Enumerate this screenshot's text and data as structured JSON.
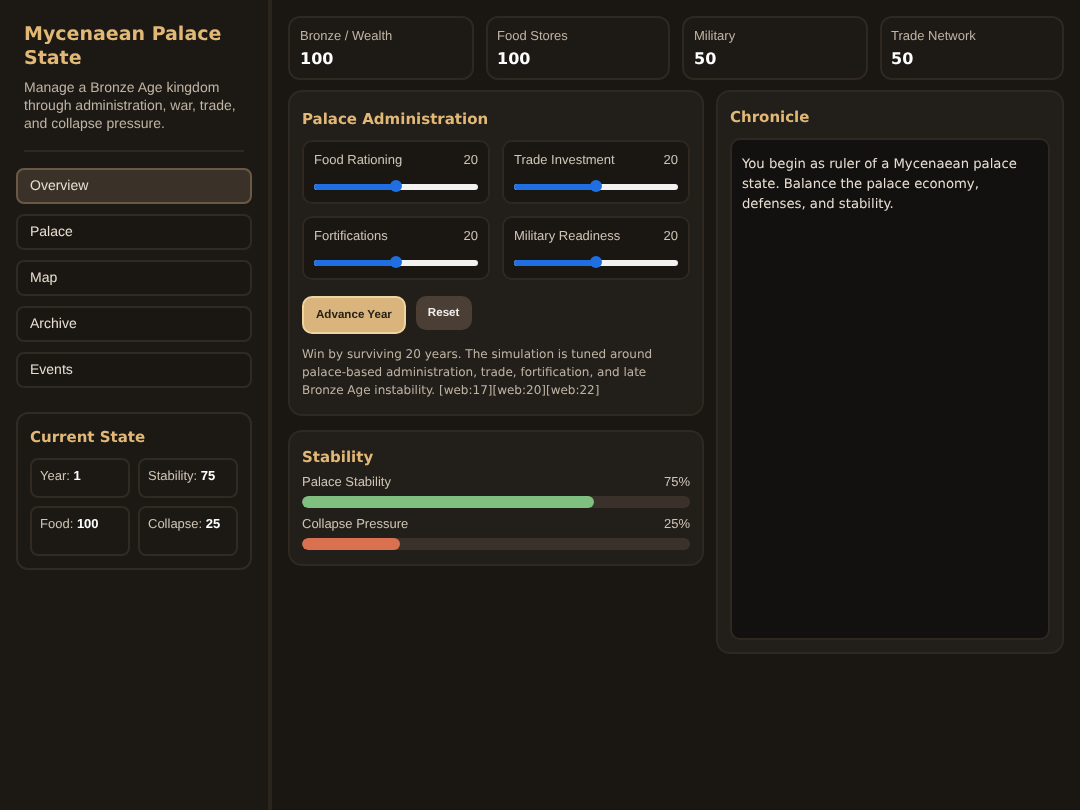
{
  "sidebar": {
    "title": "Mycenaean Palace State",
    "description": "Manage a Bronze Age kingdom through administration, war, trade, and collapse pressure.",
    "nav": [
      {
        "label": "Overview",
        "selected": true
      },
      {
        "label": "Palace",
        "selected": false
      },
      {
        "label": "Map",
        "selected": false
      },
      {
        "label": "Archive",
        "selected": false
      },
      {
        "label": "Events",
        "selected": false
      }
    ],
    "current_state": {
      "title": "Current State",
      "items": [
        "Year: **1**",
        "Stability: **75**",
        "Food: **100**",
        "Collapse: **25**"
      ]
    }
  },
  "stats": [
    {
      "label": "Bronze / Wealth",
      "value": "100"
    },
    {
      "label": "Food Stores",
      "value": "100"
    },
    {
      "label": "Military",
      "value": "50"
    },
    {
      "label": "Trade Network",
      "value": "50"
    }
  ],
  "administration": {
    "title": "Palace Administration",
    "sliders": [
      {
        "label": "Food Rationing",
        "value": "20",
        "level": 0.5
      },
      {
        "label": "Trade Investment",
        "value": "20",
        "level": 0.5
      },
      {
        "label": "Fortifications",
        "value": "20",
        "level": 0.5
      },
      {
        "label": "Military Readiness",
        "value": "20",
        "level": 0.5
      }
    ],
    "buttons": [
      {
        "label": "Advance Year",
        "kind": "primary"
      },
      {
        "label": "Reset",
        "kind": "secondary"
      }
    ],
    "note": "Win by surviving 20 years. The simulation is tuned around palace-based administration, trade, fortification, and late Bronze Age instability. [web:17][web:20][web:22]"
  },
  "stability": {
    "title": "Stability",
    "bars": [
      {
        "label": "Palace Stability",
        "reading": "75%",
        "level": 0.75,
        "color": "#7fbf7f"
      },
      {
        "label": "Collapse Pressure",
        "reading": "25%",
        "level": 0.25,
        "color": "#d9704f"
      }
    ]
  },
  "chronicle": {
    "title": "Chronicle",
    "text": "You begin as ruler of a Mycenaean palace state. Balance the palace economy, defenses, and stability."
  }
}
